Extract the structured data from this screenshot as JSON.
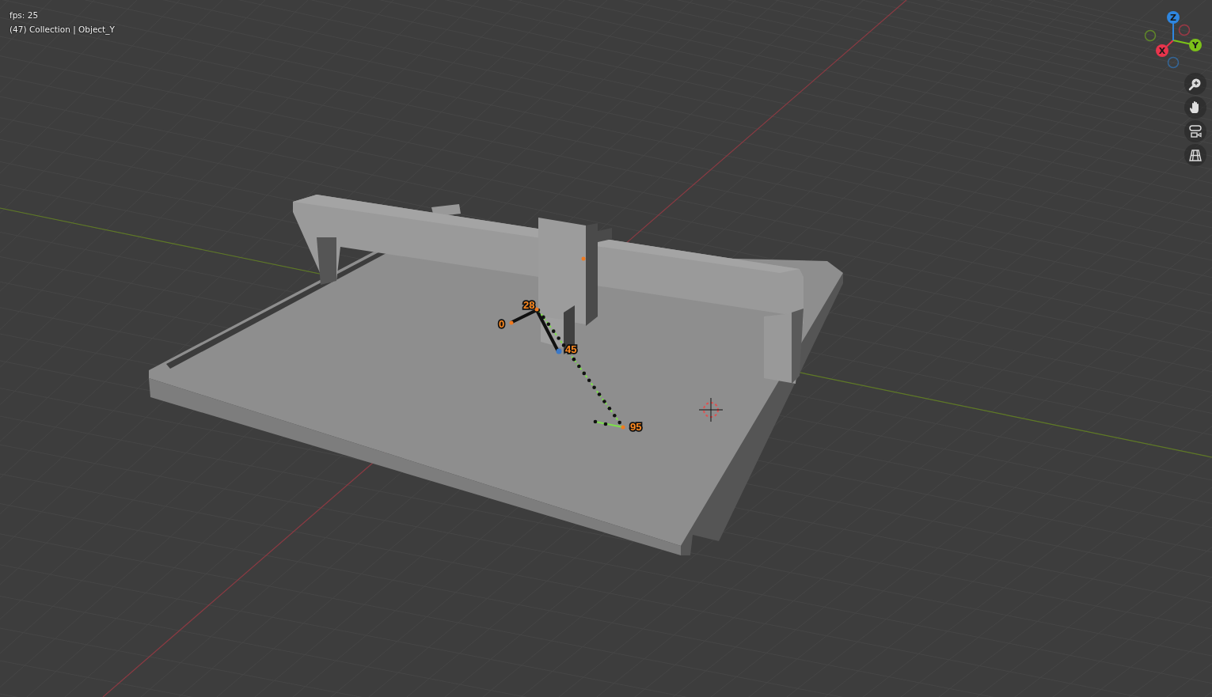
{
  "overlay": {
    "fps": "fps: 25",
    "context": "(47) Collection | Object_Y"
  },
  "gizmo": {
    "axes": [
      {
        "label": "X",
        "color": "#e8344c"
      },
      {
        "label": "Y",
        "color": "#7cc219"
      },
      {
        "label": "Z",
        "color": "#2e86e0"
      }
    ]
  },
  "navigation": [
    {
      "kind": "zoom"
    },
    {
      "kind": "pan"
    },
    {
      "kind": "camera"
    },
    {
      "kind": "perspective"
    }
  ],
  "motion_path": {
    "frame_labels": [
      {
        "text": "0"
      },
      {
        "text": "28"
      },
      {
        "text": "45"
      },
      {
        "text": "95"
      }
    ]
  }
}
